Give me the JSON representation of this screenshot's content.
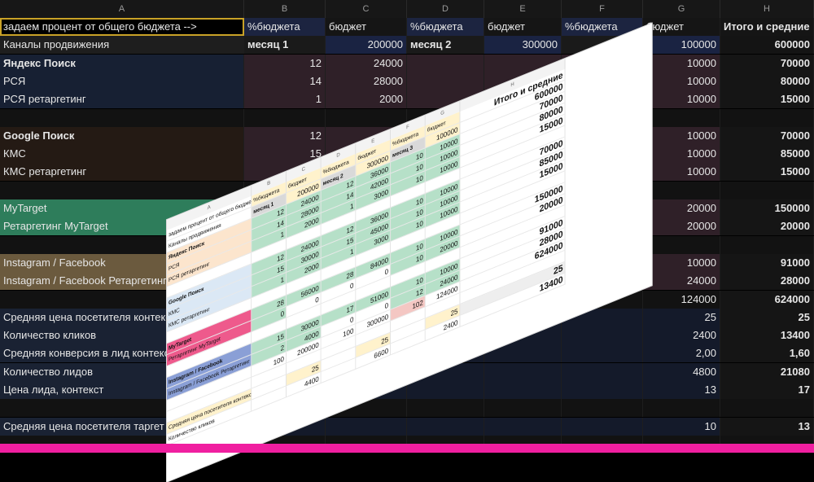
{
  "dark_sheet": {
    "column_letters": [
      "A",
      "B",
      "C",
      "D",
      "E",
      "F",
      "G",
      "H"
    ],
    "rows": [
      {
        "cells": [
          "задаем процент от общего бюджета -->",
          "%бюджета",
          "бюджет",
          "%бюджета",
          "бюджет",
          "%бюджета",
          "бюджет",
          "Итого и средние"
        ],
        "bg": [
          "#000000",
          "#1c2440",
          "#151515",
          "#1c2440",
          "#151515",
          "#1c2440",
          "#151515",
          "#151515"
        ]
      },
      {
        "cells": [
          "Каналы продвижения",
          "месяц 1",
          "200000",
          "месяц 2",
          "300000",
          "",
          "100000",
          "600000"
        ],
        "bg": [
          "#1e1e1e",
          "#1a1a1a",
          "#1a2342",
          "#1a1a1a",
          "#1a2342",
          "#1a1a1a",
          "#1a2342",
          "#141414"
        ]
      },
      {
        "cells": [
          "Яндекс Поиск",
          "12",
          "24000",
          "",
          "",
          "",
          "10000",
          "70000"
        ],
        "bg": [
          "#172033",
          "#2f2028",
          "#2f2028",
          "#2f2028",
          "#2f2028",
          "#2f2028",
          "#2f2028",
          "#151515"
        ]
      },
      {
        "cells": [
          "РСЯ",
          "14",
          "28000",
          "",
          "",
          "",
          "10000",
          "80000"
        ],
        "bg": [
          "#172033",
          "#2f2028",
          "#2f2028",
          "#2f2028",
          "#2f2028",
          "#2f2028",
          "#2f2028",
          "#151515"
        ]
      },
      {
        "cells": [
          "РСЯ ретаргетинг",
          "1",
          "2000",
          "",
          "",
          "",
          "10000",
          "15000"
        ],
        "bg": [
          "#172033",
          "#2f2028",
          "#2f2028",
          "#2f2028",
          "#2f2028",
          "#2f2028",
          "#2f2028",
          "#151515"
        ]
      },
      {
        "cells": [
          "",
          "",
          "",
          "",
          "",
          "",
          "",
          ""
        ],
        "bg": [
          "#121212",
          "#121212",
          "#121212",
          "#121212",
          "#121212",
          "#121212",
          "#121212",
          "#121212"
        ]
      },
      {
        "cells": [
          "Google Поиск",
          "12",
          "",
          "",
          "",
          "",
          "10000",
          "70000"
        ],
        "bg": [
          "#241a14",
          "#2f2028",
          "#2f2028",
          "#2f2028",
          "#2f2028",
          "#2f2028",
          "#2f2028",
          "#151515"
        ]
      },
      {
        "cells": [
          "КМС",
          "15",
          "",
          "",
          "",
          "",
          "10000",
          "85000"
        ],
        "bg": [
          "#241a14",
          "#2f2028",
          "#2f2028",
          "#2f2028",
          "#2f2028",
          "#2f2028",
          "#2f2028",
          "#151515"
        ]
      },
      {
        "cells": [
          "КМС ретаргетинг",
          "",
          "",
          "",
          "",
          "",
          "10000",
          "15000"
        ],
        "bg": [
          "#241a14",
          "#2f2028",
          "#2f2028",
          "#2f2028",
          "#2f2028",
          "#2f2028",
          "#2f2028",
          "#151515"
        ]
      },
      {
        "cells": [
          "",
          "",
          "",
          "",
          "",
          "",
          "",
          ""
        ],
        "bg": [
          "#121212",
          "#121212",
          "#121212",
          "#121212",
          "#121212",
          "#121212",
          "#121212",
          "#121212"
        ]
      },
      {
        "cells": [
          "MyTarget",
          "",
          "",
          "",
          "",
          "",
          "20000",
          "150000"
        ],
        "bg": [
          "#2e7d5b",
          "#2f2028",
          "#2f2028",
          "#2f2028",
          "#2f2028",
          "#2f2028",
          "#2f2028",
          "#151515"
        ]
      },
      {
        "cells": [
          "Ретаргетинг MyTarget",
          "",
          "",
          "",
          "",
          "",
          "20000",
          "20000"
        ],
        "bg": [
          "#2e7d5b",
          "#2f2028",
          "#2f2028",
          "#2f2028",
          "#2f2028",
          "#2f2028",
          "#2f2028",
          "#151515"
        ]
      },
      {
        "cells": [
          "",
          "",
          "",
          "",
          "",
          "",
          "",
          ""
        ],
        "bg": [
          "#121212",
          "#121212",
          "#121212",
          "#121212",
          "#121212",
          "#121212",
          "#121212",
          "#121212"
        ]
      },
      {
        "cells": [
          "Instagram / Facebook",
          "",
          "",
          "",
          "",
          "",
          "10000",
          "91000"
        ],
        "bg": [
          "#6b5a3e",
          "#2f2028",
          "#2f2028",
          "#2f2028",
          "#2f2028",
          "#2f2028",
          "#2f2028",
          "#151515"
        ]
      },
      {
        "cells": [
          "Instagram / Facebook Ретаргетинг",
          "",
          "",
          "",
          "",
          "",
          "24000",
          "28000"
        ],
        "bg": [
          "#6b5a3e",
          "#2f2028",
          "#2f2028",
          "#2f2028",
          "#2f2028",
          "#2f2028",
          "#2f2028",
          "#151515"
        ]
      },
      {
        "cells": [
          "",
          "",
          "",
          "",
          "",
          "",
          "124000",
          "624000"
        ],
        "bg": [
          "#121212",
          "#121212",
          "#121212",
          "#121212",
          "#121212",
          "#121212",
          "#121212",
          "#151515"
        ]
      },
      {
        "cells": [
          "Средняя цена посетителя контекст",
          "",
          "",
          "",
          "",
          "",
          "25",
          "25"
        ],
        "bg": [
          "#1a2233",
          "#141a2a",
          "#141a2a",
          "#141a2a",
          "#141a2a",
          "#141a2a",
          "#141a2a",
          "#151515"
        ]
      },
      {
        "cells": [
          "Количество кликов",
          "",
          "",
          "",
          "",
          "",
          "2400",
          "13400"
        ],
        "bg": [
          "#1a2233",
          "#141a2a",
          "#141a2a",
          "#141a2a",
          "#141a2a",
          "#141a2a",
          "#141a2a",
          "#151515"
        ]
      },
      {
        "cells": [
          "Средняя конверсия в лид контекст",
          "",
          "",
          "",
          "",
          "",
          "2,00",
          "1,60"
        ],
        "bg": [
          "#1a2233",
          "#141a2a",
          "#141a2a",
          "#141a2a",
          "#141a2a",
          "#141a2a",
          "#141a2a",
          "#151515"
        ]
      },
      {
        "cells": [
          "Количество лидов",
          "",
          "",
          "",
          "",
          "",
          "4800",
          "21080"
        ],
        "bg": [
          "#1a2233",
          "#141a2a",
          "#141a2a",
          "#141a2a",
          "#141a2a",
          "#141a2a",
          "#141a2a",
          "#151515"
        ]
      },
      {
        "cells": [
          "Цена лида, контекст",
          "",
          "",
          "",
          "",
          "",
          "13",
          "17"
        ],
        "bg": [
          "#1a2233",
          "#141a2a",
          "#141a2a",
          "#141a2a",
          "#141a2a",
          "#141a2a",
          "#141a2a",
          "#151515"
        ]
      },
      {
        "cells": [
          "",
          "",
          "",
          "",
          "",
          "",
          "",
          ""
        ],
        "bg": [
          "#121212",
          "#121212",
          "#121212",
          "#121212",
          "#121212",
          "#121212",
          "#121212",
          "#121212"
        ]
      },
      {
        "cells": [
          "Средняя цена посетителя таргет",
          "",
          "",
          "",
          "",
          "",
          "10",
          "13"
        ],
        "bg": [
          "#1a2233",
          "#141a2a",
          "#141a2a",
          "#141a2a",
          "#141a2a",
          "#141a2a",
          "#141a2a",
          "#151515"
        ]
      },
      {
        "cells": [
          "",
          "",
          "",
          "",
          "",
          "",
          "",
          ""
        ],
        "bg": [
          "#121212",
          "#121212",
          "#121212",
          "#121212",
          "#121212",
          "#121212",
          "#121212",
          "#121212"
        ]
      }
    ]
  },
  "light_sheet": {
    "column_letters": [
      "A",
      "B",
      "C",
      "D",
      "E",
      "F",
      "G",
      "H"
    ],
    "rows": [
      {
        "cells": [
          "задаем процент от общего бюджета -->",
          "%бюджета",
          "бюджет",
          "%бюджета",
          "бюджет",
          "%бюджета",
          "бюджет",
          "Итого и средние"
        ],
        "bg": [
          "#ffffff",
          "#fff2cc",
          "#fff2cc",
          "#fff2cc",
          "#fff2cc",
          "#fff2cc",
          "#fff2cc",
          "#ffffff"
        ]
      },
      {
        "cells": [
          "Каналы продвижения",
          "месяц 1",
          "200000",
          "месяц 2",
          "300000",
          "месяц 3",
          "100000",
          "600000"
        ],
        "bg": [
          "#ffffff",
          "#d9d9d9",
          "#fff2cc",
          "#d9d9d9",
          "#fff2cc",
          "#d9d9d9",
          "#fff2cc",
          "#ffffff"
        ]
      },
      {
        "cells": [
          "Яндекс Поиск",
          "12",
          "24000",
          "12",
          "36000",
          "10",
          "10000",
          "70000"
        ],
        "bg": [
          "#fce5cd",
          "#b6e0c8",
          "#b6e0c8",
          "#b6e0c8",
          "#b6e0c8",
          "#b6e0c8",
          "#b6e0c8",
          "#ffffff"
        ]
      },
      {
        "cells": [
          "РСЯ",
          "14",
          "28000",
          "14",
          "42000",
          "10",
          "10000",
          "80000"
        ],
        "bg": [
          "#fce5cd",
          "#b6e0c8",
          "#b6e0c8",
          "#b6e0c8",
          "#b6e0c8",
          "#b6e0c8",
          "#b6e0c8",
          "#ffffff"
        ]
      },
      {
        "cells": [
          "РСЯ ретаргетинг",
          "1",
          "2000",
          "1",
          "3000",
          "10",
          "10000",
          "15000"
        ],
        "bg": [
          "#fce5cd",
          "#b6e0c8",
          "#b6e0c8",
          "#b6e0c8",
          "#b6e0c8",
          "#b6e0c8",
          "#b6e0c8",
          "#ffffff"
        ]
      },
      {
        "cells": [
          "",
          "",
          "",
          "",
          "",
          "",
          "",
          ""
        ],
        "bg": [
          "#ffffff",
          "#ffffff",
          "#ffffff",
          "#ffffff",
          "#ffffff",
          "#ffffff",
          "#ffffff",
          "#ffffff"
        ]
      },
      {
        "cells": [
          "Google Поиск",
          "12",
          "24000",
          "12",
          "36000",
          "10",
          "10000",
          "70000"
        ],
        "bg": [
          "#dbe8f5",
          "#b6e0c8",
          "#b6e0c8",
          "#b6e0c8",
          "#b6e0c8",
          "#b6e0c8",
          "#b6e0c8",
          "#ffffff"
        ]
      },
      {
        "cells": [
          "КМС",
          "15",
          "30000",
          "15",
          "45000",
          "10",
          "10000",
          "85000"
        ],
        "bg": [
          "#dbe8f5",
          "#b6e0c8",
          "#b6e0c8",
          "#b6e0c8",
          "#b6e0c8",
          "#b6e0c8",
          "#b6e0c8",
          "#ffffff"
        ]
      },
      {
        "cells": [
          "КМС ретаргетинг",
          "1",
          "2000",
          "1",
          "3000",
          "10",
          "10000",
          "15000"
        ],
        "bg": [
          "#dbe8f5",
          "#b6e0c8",
          "#b6e0c8",
          "#b6e0c8",
          "#b6e0c8",
          "#b6e0c8",
          "#b6e0c8",
          "#ffffff"
        ]
      },
      {
        "cells": [
          "",
          "",
          "",
          "",
          "",
          "",
          "",
          ""
        ],
        "bg": [
          "#ffffff",
          "#ffffff",
          "#ffffff",
          "#ffffff",
          "#ffffff",
          "#ffffff",
          "#ffffff",
          "#ffffff"
        ]
      },
      {
        "cells": [
          "MyTarget",
          "28",
          "56000",
          "28",
          "84000",
          "10",
          "10000",
          "150000"
        ],
        "bg": [
          "#ee5a8c",
          "#b6e0c8",
          "#b6e0c8",
          "#b6e0c8",
          "#b6e0c8",
          "#b6e0c8",
          "#b6e0c8",
          "#ffffff"
        ]
      },
      {
        "cells": [
          "Ретаргетинг MyTarget",
          "0",
          "0",
          "0",
          "0",
          "10",
          "20000",
          "20000"
        ],
        "bg": [
          "#ee5a8c",
          "#b6e0c8",
          "#ffffff",
          "#ffffff",
          "#ffffff",
          "#b6e0c8",
          "#b6e0c8",
          "#ffffff"
        ]
      },
      {
        "cells": [
          "",
          "",
          "",
          "",
          "",
          "",
          "",
          ""
        ],
        "bg": [
          "#ffffff",
          "#ffffff",
          "#ffffff",
          "#ffffff",
          "#ffffff",
          "#ffffff",
          "#ffffff",
          "#ffffff"
        ]
      },
      {
        "cells": [
          "Instagram / Facebook",
          "15",
          "30000",
          "17",
          "51000",
          "10",
          "10000",
          "91000"
        ],
        "bg": [
          "#8a9fd6",
          "#b6e0c8",
          "#b6e0c8",
          "#b6e0c8",
          "#b6e0c8",
          "#b6e0c8",
          "#b6e0c8",
          "#ffffff"
        ]
      },
      {
        "cells": [
          "Instagram / Facebook Ретаргетинг",
          "2",
          "4000",
          "0",
          "0",
          "12",
          "24000",
          "28000"
        ],
        "bg": [
          "#8a9fd6",
          "#b6e0c8",
          "#b6e0c8",
          "#ffffff",
          "#ffffff",
          "#b6e0c8",
          "#b6e0c8",
          "#ffffff"
        ]
      },
      {
        "cells": [
          "",
          "100",
          "200000",
          "100",
          "300000",
          "102",
          "124000",
          "624000"
        ],
        "bg": [
          "#ffffff",
          "#ffffff",
          "#ffffff",
          "#ffffff",
          "#ffffff",
          "#f4c7c3",
          "#ffffff",
          "#ffffff"
        ]
      },
      {
        "cells": [
          "",
          "",
          "",
          "",
          "",
          "",
          "",
          ""
        ],
        "bg": [
          "#ffffff",
          "#ffffff",
          "#ffffff",
          "#ffffff",
          "#ffffff",
          "#ffffff",
          "#ffffff",
          "#ffffff"
        ]
      },
      {
        "cells": [
          "Средняя цена посетителя контекст",
          "",
          "25",
          "",
          "25",
          "",
          "25",
          "25"
        ],
        "bg": [
          "#fff2cc",
          "#ffffff",
          "#fff2cc",
          "#ffffff",
          "#fff2cc",
          "#ffffff",
          "#fff2cc",
          "#eeeeee"
        ]
      },
      {
        "cells": [
          "Количество кликов",
          "",
          "4400",
          "",
          "6600",
          "",
          "2400",
          "13400"
        ],
        "bg": [
          "#ffffff",
          "#ffffff",
          "#ffffff",
          "#ffffff",
          "#ffffff",
          "#ffffff",
          "#ffffff",
          "#ffffff"
        ]
      }
    ]
  },
  "colors": {
    "accent_stripe": "#f01fa0",
    "selected_cell_border": "#c9a227"
  }
}
